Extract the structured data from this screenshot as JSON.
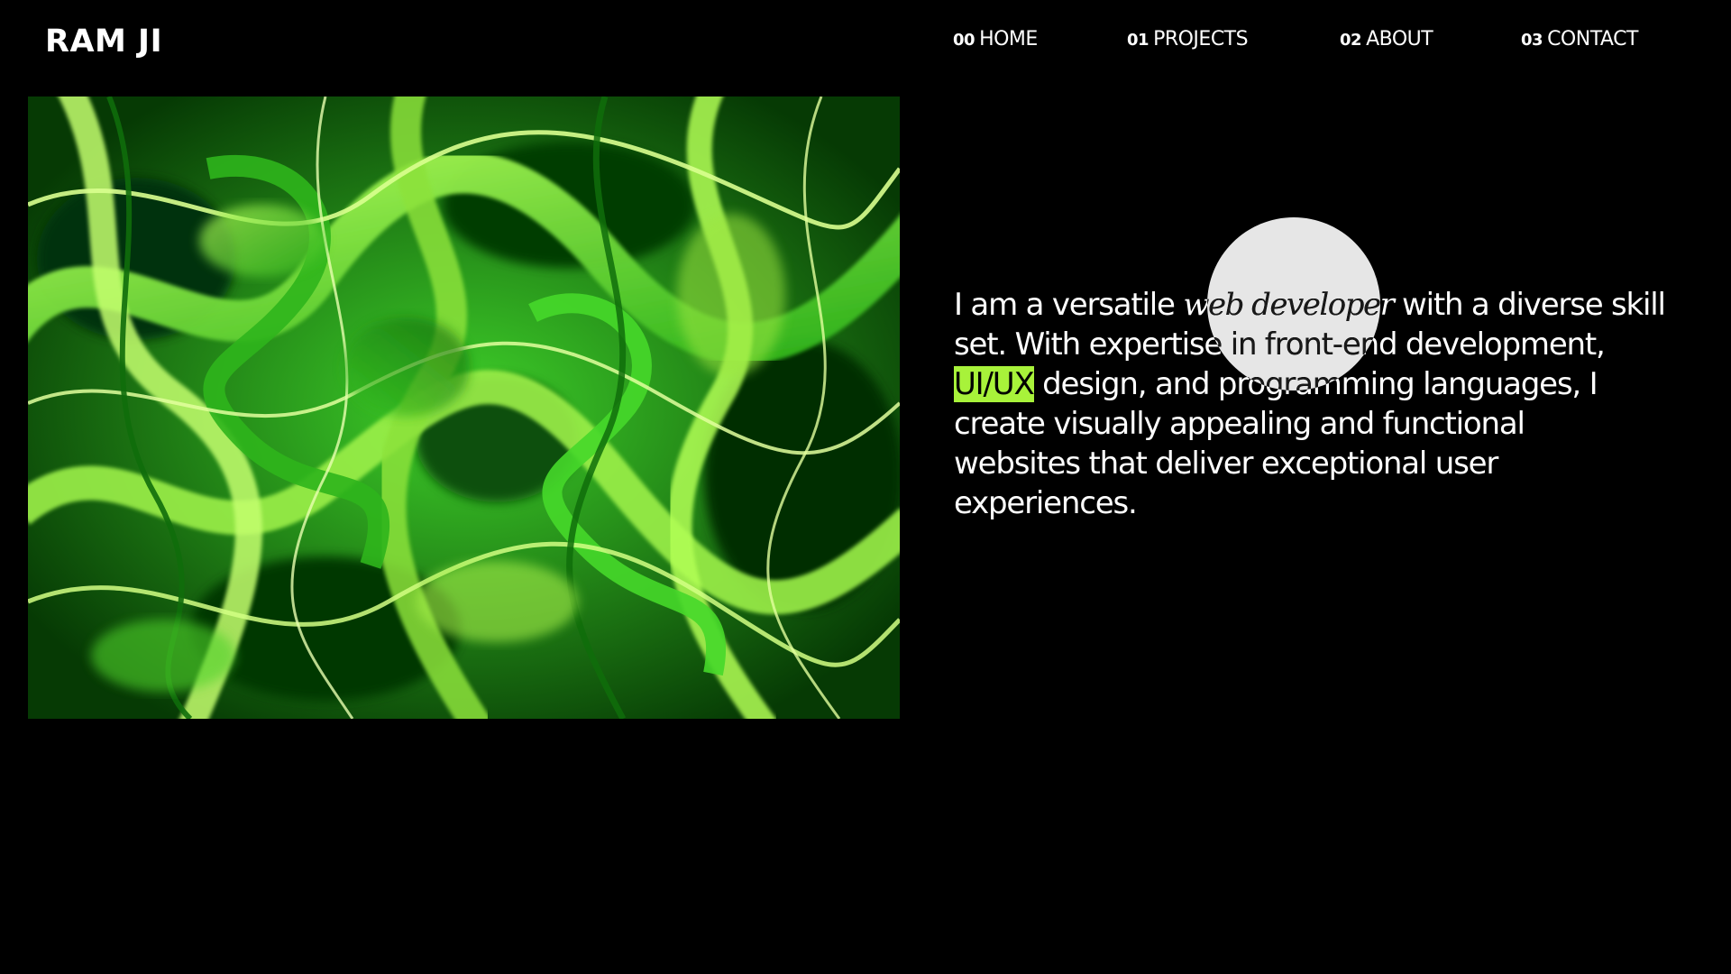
{
  "header": {
    "logo": "RAM JI",
    "nav": [
      {
        "num": "00",
        "label": "HOME"
      },
      {
        "num": "01",
        "label": "PROJECTS"
      },
      {
        "num": "02",
        "label": "ABOUT"
      },
      {
        "num": "03",
        "label": "CONTACT"
      }
    ]
  },
  "intro": {
    "l1_a": "I am a versatile ",
    "l1_em": "web developer",
    "l1_b": " with a diverse skill",
    "l2": "set. With expertise in front-end development,",
    "l3_hl": "UI/UX",
    "l3_b": " design, and programming languages, I",
    "l4": "create visually appealing and functional",
    "l5": "websites that deliver exceptional user",
    "l6": "experiences."
  },
  "colors": {
    "background": "#000000",
    "text": "#ffffff",
    "accent_highlight": "#a8f23a",
    "art_green_dark": "#0a4d06",
    "art_green_mid": "#2fb51c",
    "art_green_light": "#b6ff5a",
    "cursor_circle": "#e6e6e6"
  },
  "art": {
    "icon": "abstract-green-swirl-artwork"
  }
}
